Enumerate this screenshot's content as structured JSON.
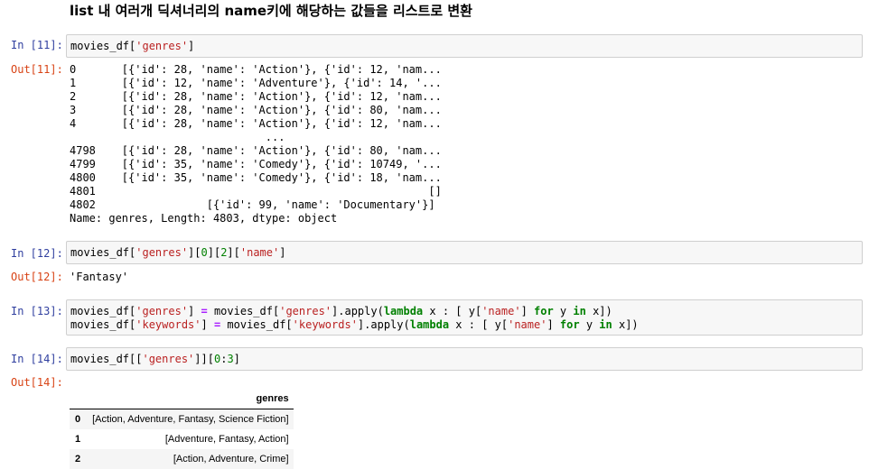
{
  "heading": "list 내 여러개 딕셔너리의 name키에 해당하는 값들을 리스트로 변환",
  "cells": {
    "c11": {
      "in_prompt": "In [11]:",
      "out_prompt": "Out[11]:",
      "code": [
        "movies_df[",
        "'genres'",
        "]"
      ]
    },
    "c12": {
      "in_prompt": "In [12]:",
      "out_prompt": "Out[12]:",
      "code": [
        "movies_df[",
        "'genres'",
        "][",
        "0",
        "][",
        "2",
        "][",
        "'name'",
        "]"
      ],
      "output": "'Fantasy'"
    },
    "c13": {
      "in_prompt": "In [13]:",
      "line1": [
        "movies_df[",
        "'genres'",
        "] ",
        "=",
        " movies_df[",
        "'genres'",
        "].apply(",
        "lambda",
        " x : [ y[",
        "'name'",
        "] ",
        "for",
        " y ",
        "in",
        " x])"
      ],
      "line2": [
        "movies_df[",
        "'keywords'",
        "] ",
        "=",
        " movies_df[",
        "'keywords'",
        "].apply(",
        "lambda",
        " x : [ y[",
        "'name'",
        "] ",
        "for",
        " y ",
        "in",
        " x])"
      ]
    },
    "c14": {
      "in_prompt": "In [14]:",
      "out_prompt": "Out[14]:",
      "code": [
        "movies_df[[",
        "'genres'",
        "]][",
        "0",
        ":",
        "3",
        "]"
      ]
    }
  },
  "series_output": {
    "lines": [
      "0       [{'id': 28, 'name': 'Action'}, {'id': 12, 'nam...",
      "1       [{'id': 12, 'name': 'Adventure'}, {'id': 14, '...",
      "2       [{'id': 28, 'name': 'Action'}, {'id': 12, 'nam...",
      "3       [{'id': 28, 'name': 'Action'}, {'id': 80, 'nam...",
      "4       [{'id': 28, 'name': 'Action'}, {'id': 12, 'nam...",
      "                              ...",
      "4798    [{'id': 28, 'name': 'Action'}, {'id': 80, 'nam...",
      "4799    [{'id': 35, 'name': 'Comedy'}, {'id': 10749, '...",
      "4800    [{'id': 35, 'name': 'Comedy'}, {'id': 18, 'nam...",
      "4801                                                   []",
      "4802                 [{'id': 99, 'name': 'Documentary'}]",
      "Name: genres, Length: 4803, dtype: object"
    ]
  },
  "dataframe": {
    "column": "genres",
    "rows": [
      {
        "index": "0",
        "value": "[Action, Adventure, Fantasy, Science Fiction]"
      },
      {
        "index": "1",
        "value": "[Adventure, Fantasy, Action]"
      },
      {
        "index": "2",
        "value": "[Action, Adventure, Crime]"
      }
    ]
  },
  "colors": {
    "in_prompt": "#303f9f",
    "out_prompt": "#d84315",
    "string": "#ba2121",
    "keyword": "#008000",
    "operator": "#aa22ff",
    "input_bg": "#f7f7f7"
  }
}
